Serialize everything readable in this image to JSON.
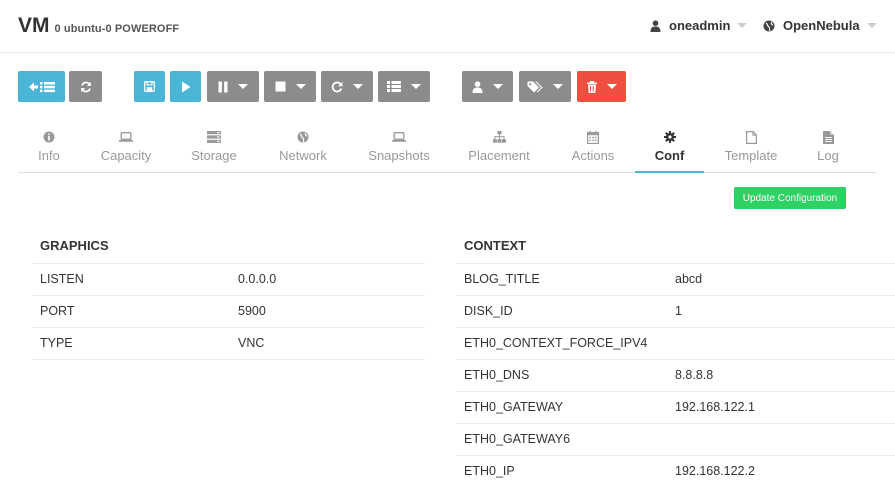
{
  "header": {
    "title": "VM",
    "subtitle": "0 ubuntu-0 POWEROFF",
    "user": "oneadmin",
    "zone": "OpenNebula"
  },
  "tabs": [
    {
      "label": "Info",
      "icon": "info-icon"
    },
    {
      "label": "Capacity",
      "icon": "laptop-icon"
    },
    {
      "label": "Storage",
      "icon": "storage-icon"
    },
    {
      "label": "Network",
      "icon": "globe-icon"
    },
    {
      "label": "Snapshots",
      "icon": "laptop-icon"
    },
    {
      "label": "Placement",
      "icon": "sitemap-icon"
    },
    {
      "label": "Actions",
      "icon": "calendar-icon"
    },
    {
      "label": "Conf",
      "icon": "gear-icon",
      "active": true
    },
    {
      "label": "Template",
      "icon": "file-icon"
    },
    {
      "label": "Log",
      "icon": "file-text-icon"
    }
  ],
  "update_button": "Update Configuration",
  "graphics": {
    "title": "GRAPHICS",
    "rows": [
      {
        "key": "LISTEN",
        "value": "0.0.0.0"
      },
      {
        "key": "PORT",
        "value": "5900"
      },
      {
        "key": "TYPE",
        "value": "VNC"
      }
    ]
  },
  "context": {
    "title": "CONTEXT",
    "rows": [
      {
        "key": "BLOG_TITLE",
        "value": "abcd"
      },
      {
        "key": "DISK_ID",
        "value": "1"
      },
      {
        "key": "ETH0_CONTEXT_FORCE_IPV4",
        "value": ""
      },
      {
        "key": "ETH0_DNS",
        "value": "8.8.8.8"
      },
      {
        "key": "ETH0_GATEWAY",
        "value": "192.168.122.1"
      },
      {
        "key": "ETH0_GATEWAY6",
        "value": ""
      },
      {
        "key": "ETH0_IP",
        "value": "192.168.122.2"
      }
    ]
  },
  "colors": {
    "blue": "#4ab5d6",
    "gray": "#8c8c8c",
    "red": "#ef4f3e",
    "green": "#2dd164"
  }
}
